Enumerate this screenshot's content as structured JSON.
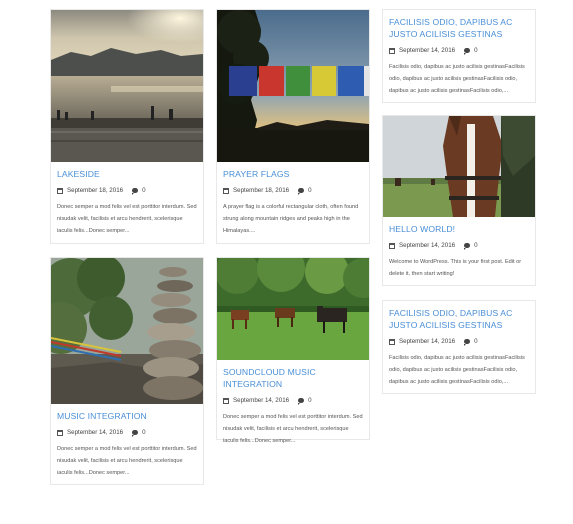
{
  "posts": [
    {
      "title": "LAKESIDE",
      "date": "September 18, 2016",
      "comments": "0",
      "excerpt": "Donec semper a mod felis vel est porttitor interdum. Sed nisudak velit, facilisis et arcu hendrerit, scelerisque iaculis felis...Donec semper..."
    },
    {
      "title": "PRAYER FLAGS",
      "date": "September 18, 2016",
      "comments": "0",
      "excerpt": "A prayer flag is a colorful rectangular cloth, often found strung along mountain ridges and peaks high in the Himalayas...."
    },
    {
      "title": "FACILISIS ODIO, DAPIBUS AC JUSTO ACILISIS GESTINAS",
      "date": "September 14, 2016",
      "comments": "0",
      "excerpt": "Facilisis odio, dapibus ac justo acilisis gestinasFacilisis odio, dapibus ac justo acilisis gestinasFacilisis odio, dapibus ac justo acilisis gestinasFacilisis odio,..."
    },
    {
      "title": "HELLO WORLD!",
      "date": "September 14, 2016",
      "comments": "0",
      "excerpt": "Welcome to WordPress. This is your first post. Edit or delete it, then start writing!"
    },
    {
      "title": "MUSIC INTEGRATION",
      "date": "September 14, 2016",
      "comments": "0",
      "excerpt": "Donec semper a mod felis vel est porttitor interdum. Sed nisudak velit, facilisis et arcu hendrerit, scelerisque iaculis felis...Donec semper..."
    },
    {
      "title": "SOUNDCLOUD MUSIC INTEGRATION",
      "date": "September 14, 2016",
      "comments": "0",
      "excerpt": "Donec semper a mod felis vel est porttitor interdum. Sed nisudak velit, facilisis et arcu hendrerit, scelerisque iaculis felis...Donec semper..."
    },
    {
      "title": "FACILISIS ODIO, DAPIBUS AC JUSTO ACILISIS GESTINAS",
      "date": "September 14, 2016",
      "comments": "0",
      "excerpt": "Facilisis odio, dapibus ac justo acilisis gestinasFacilisis odio, dapibus ac justo acilisis gestinasFacilisis odio, dapibus ac justo acilisis gestinasFacilisis odio,..."
    }
  ],
  "colors": {
    "title": "#4a8fd6",
    "border": "#e8e8e8",
    "text": "#555555"
  },
  "icons": {
    "date": "calendar-icon",
    "comments": "comment-icon"
  }
}
